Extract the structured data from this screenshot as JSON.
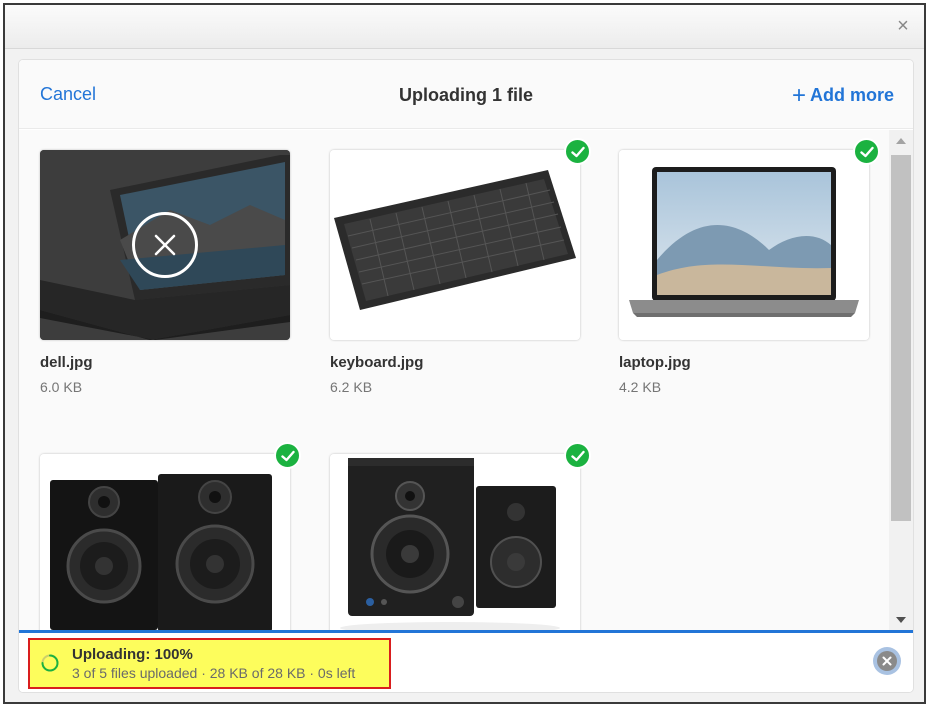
{
  "dialog": {
    "close_glyph": "×"
  },
  "header": {
    "cancel_label": "Cancel",
    "title": "Uploading 1 file",
    "add_more_label": "Add more",
    "add_more_glyph": "+"
  },
  "files": [
    {
      "name": "dell.jpg",
      "size": "6.0 KB",
      "state": "uploading",
      "image": "laptop-dark-icon"
    },
    {
      "name": "keyboard.jpg",
      "size": "6.2 KB",
      "state": "complete",
      "image": "keyboard-icon"
    },
    {
      "name": "laptop.jpg",
      "size": "4.2 KB",
      "state": "complete",
      "image": "laptop-icon"
    },
    {
      "name": "",
      "size": "",
      "state": "complete",
      "image": "speakers-icon"
    },
    {
      "name": "",
      "size": "",
      "state": "complete",
      "image": "speakers-icon"
    }
  ],
  "status": {
    "title": "Uploading: 100%",
    "detail": "3 of 5 files uploaded · 28 KB of 28 KB · 0s left"
  },
  "colors": {
    "accent": "#2275d7",
    "success": "#1bb240",
    "highlight": "#fdfd5c",
    "highlight_border": "#d91e1e"
  }
}
